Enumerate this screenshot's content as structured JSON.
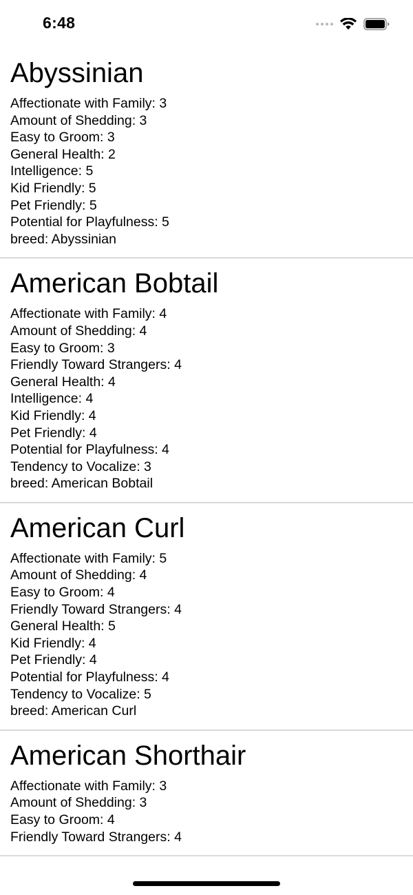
{
  "status_bar": {
    "time": "6:48"
  },
  "breeds": [
    {
      "name": "Abyssinian",
      "traits": [
        "Affectionate with Family: 3",
        "Amount of Shedding: 3",
        "Easy to Groom: 3",
        "General Health: 2",
        "Intelligence: 5",
        "Kid Friendly: 5",
        "Pet Friendly: 5",
        "Potential for Playfulness: 5",
        "breed: Abyssinian"
      ]
    },
    {
      "name": "American Bobtail",
      "traits": [
        "Affectionate with Family: 4",
        "Amount of Shedding: 4",
        "Easy to Groom: 3",
        "Friendly Toward Strangers: 4",
        "General Health: 4",
        "Intelligence: 4",
        "Kid Friendly: 4",
        "Pet Friendly: 4",
        "Potential for Playfulness: 4",
        "Tendency to Vocalize: 3",
        "breed: American Bobtail"
      ]
    },
    {
      "name": "American Curl",
      "traits": [
        "Affectionate with Family: 5",
        "Amount of Shedding: 4",
        "Easy to Groom: 4",
        "Friendly Toward Strangers: 4",
        "General Health: 5",
        "Kid Friendly: 4",
        "Pet Friendly: 4",
        "Potential for Playfulness: 4",
        "Tendency to Vocalize: 5",
        "breed: American Curl"
      ]
    },
    {
      "name": "American Shorthair",
      "traits": [
        "Affectionate with Family: 3",
        "Amount of Shedding: 3",
        "Easy to Groom: 4",
        "Friendly Toward Strangers: 4"
      ]
    }
  ]
}
